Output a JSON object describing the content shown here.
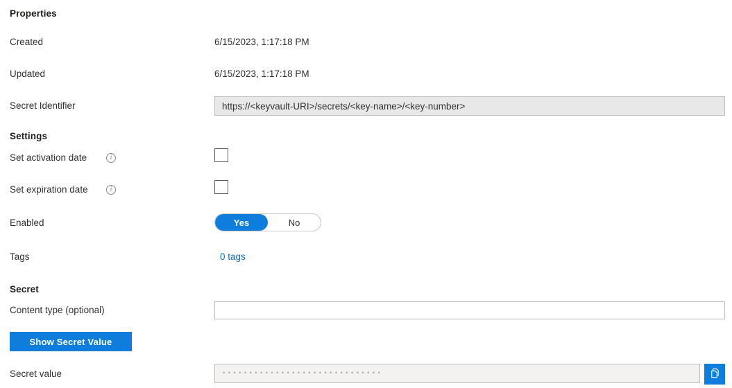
{
  "sections": {
    "properties_header": "Properties",
    "settings_header": "Settings",
    "secret_header": "Secret"
  },
  "properties": {
    "created_label": "Created",
    "created_value": "6/15/2023, 1:17:18 PM",
    "updated_label": "Updated",
    "updated_value": "6/15/2023, 1:17:18 PM",
    "secret_identifier_label": "Secret Identifier",
    "secret_identifier_value": "https://<keyvault-URI>/secrets/<key-name>/<key-number>"
  },
  "settings": {
    "activation_label": "Set activation date",
    "activation_info_icon": "info-icon",
    "activation_checked": false,
    "expiration_label": "Set expiration date",
    "expiration_info_icon": "info-icon",
    "expiration_checked": false,
    "enabled_label": "Enabled",
    "enabled_yes": "Yes",
    "enabled_no": "No",
    "enabled_selected": "Yes",
    "tags_label": "Tags",
    "tags_link": "0 tags"
  },
  "secret": {
    "content_type_label": "Content type (optional)",
    "content_type_value": "",
    "content_type_placeholder": "",
    "show_secret_button": "Show Secret Value",
    "secret_value_label": "Secret value",
    "secret_value_masked": "••••••••••••••••••••••••••••••",
    "copy_icon": "copy-icon"
  },
  "colors": {
    "accent": "#0f7ddb",
    "link": "#0f6cbd",
    "text": "#323130",
    "readonly_bg": "#e8e8e8",
    "masked_bg": "#f3f2f1",
    "border": "#bcbcbc"
  }
}
